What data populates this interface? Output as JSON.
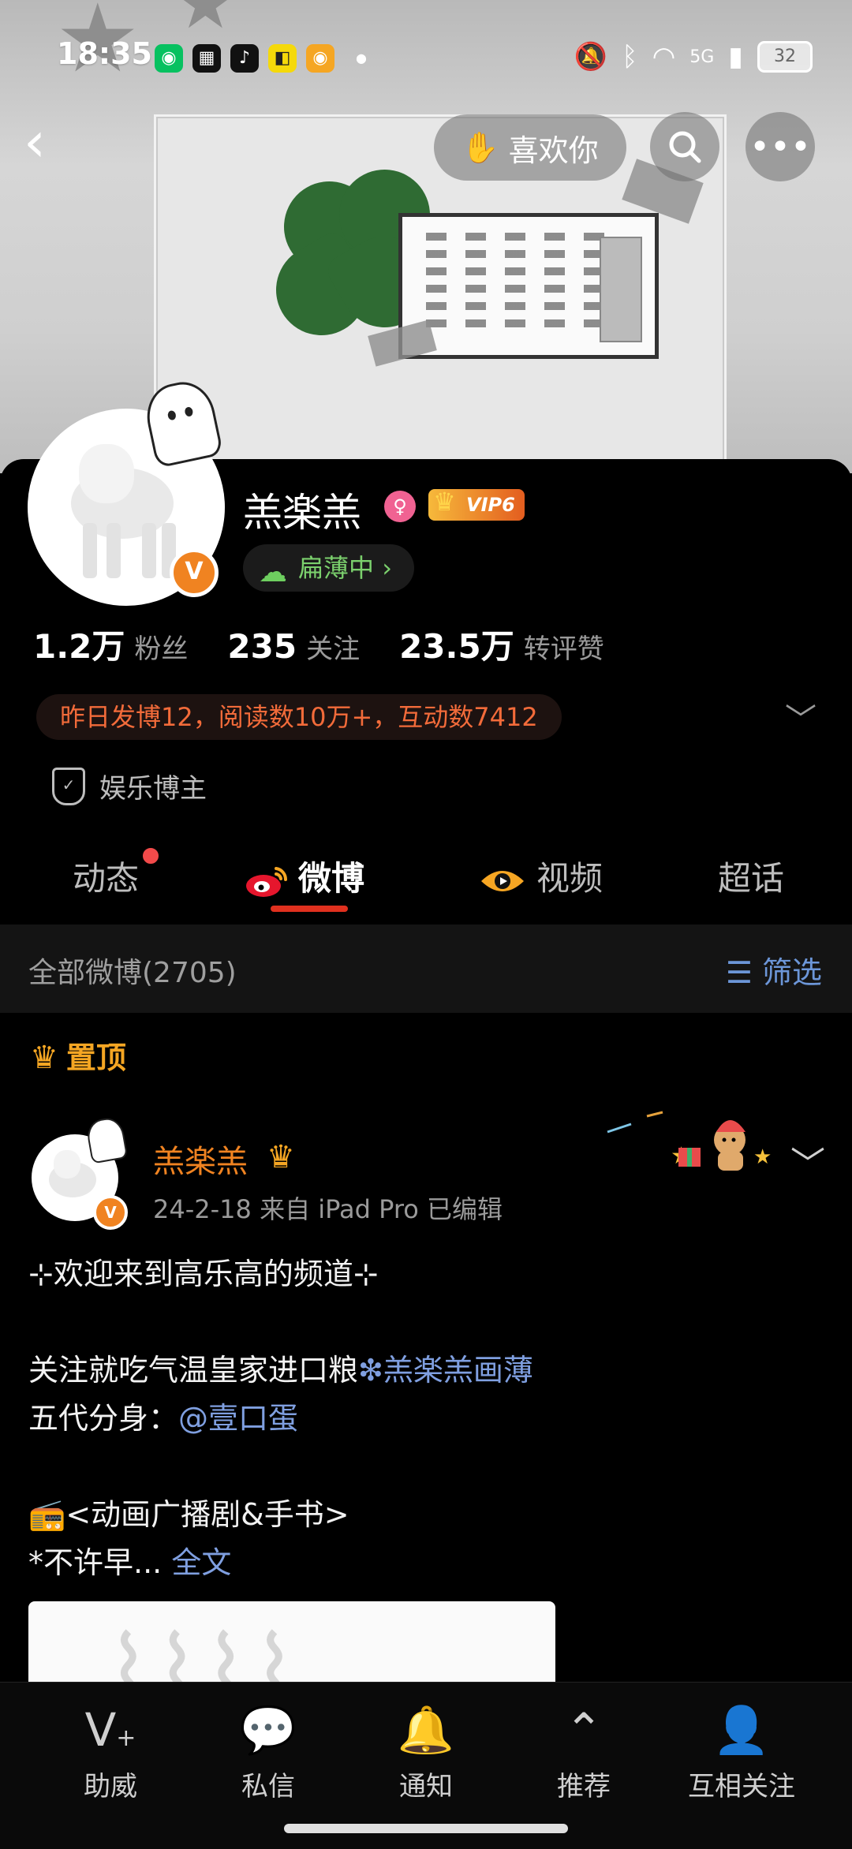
{
  "status_bar": {
    "time": "18:35",
    "battery": "32",
    "network": "5G"
  },
  "header": {
    "like_label": "喜欢你",
    "icons": [
      "back-icon",
      "search-icon",
      "more-icon"
    ]
  },
  "profile": {
    "name": "羔楽羔",
    "vip_label": "VIP6",
    "status_label": "扁薄中",
    "stats": [
      {
        "value": "1.2万",
        "label": "粉丝"
      },
      {
        "value": "235",
        "label": "关注"
      },
      {
        "value": "23.5万",
        "label": "转评赞"
      }
    ],
    "activity_text": "昨日发博12，阅读数10万+，互动数7412",
    "tag": "娱乐博主"
  },
  "tabs": [
    {
      "label": "动态"
    },
    {
      "label": "微博"
    },
    {
      "label": "视频"
    },
    {
      "label": "超话"
    }
  ],
  "filter": {
    "count_label": "全部微博(2705)",
    "filter_label": "筛选"
  },
  "pinned_label": "置顶",
  "post": {
    "author": "羔楽羔",
    "meta": "24-2-18  来自 iPad Pro  已编辑",
    "line1": "⊹欢迎来到高乐高的频道⊹",
    "line2_prefix": "关注就吃气温皇家进口粮",
    "line2_link": "❇羔楽羔画薄",
    "line3_prefix": "五代分身：",
    "line3_link": "@壹口蛋",
    "line4": "📻<动画广播剧&手书>",
    "line5_prefix": "*不许早... ",
    "line5_link": "全文"
  },
  "bottom_nav": [
    {
      "label": "助威"
    },
    {
      "label": "私信"
    },
    {
      "label": "通知"
    },
    {
      "label": "推荐"
    },
    {
      "label": "互相关注"
    }
  ],
  "colors": {
    "accent_orange": "#f08321",
    "link_blue": "#7f9fe0",
    "tab_underline": "#e0301e",
    "activity_text": "#f26b3a"
  }
}
